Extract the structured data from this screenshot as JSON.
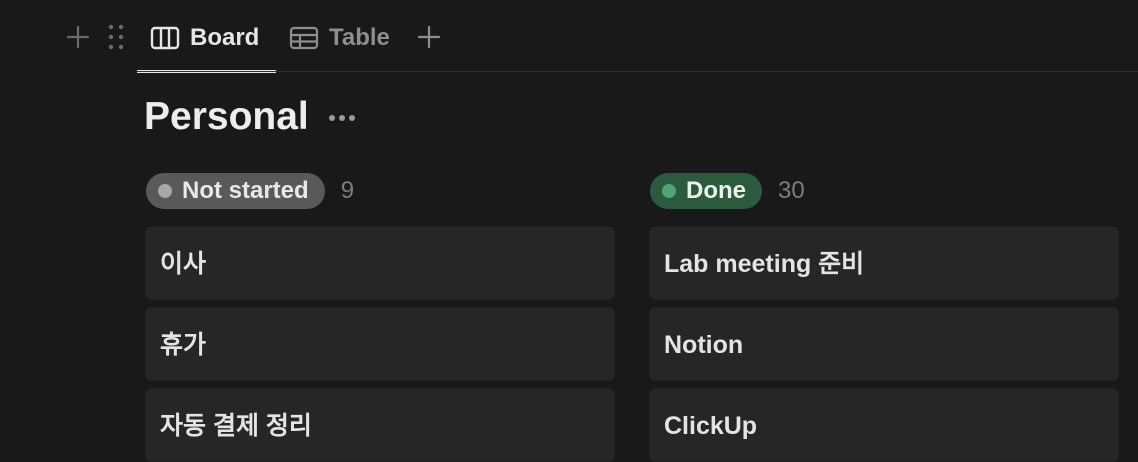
{
  "view_tabs": [
    {
      "label": "Board",
      "icon": "board-icon",
      "active": true
    },
    {
      "label": "Table",
      "icon": "table-icon",
      "active": false
    }
  ],
  "database": {
    "title": "Personal"
  },
  "columns": [
    {
      "status": "Not started",
      "count": "9",
      "color": "#595959",
      "dot_color": "#a8a8a8",
      "cards": [
        "이사",
        "휴가",
        "자동 결제 정리"
      ]
    },
    {
      "status": "Done",
      "count": "30",
      "color": "#2b5a3f",
      "dot_color": "#4fa672",
      "cards": [
        "Lab meeting 준비",
        "Notion",
        "ClickUp"
      ]
    }
  ]
}
